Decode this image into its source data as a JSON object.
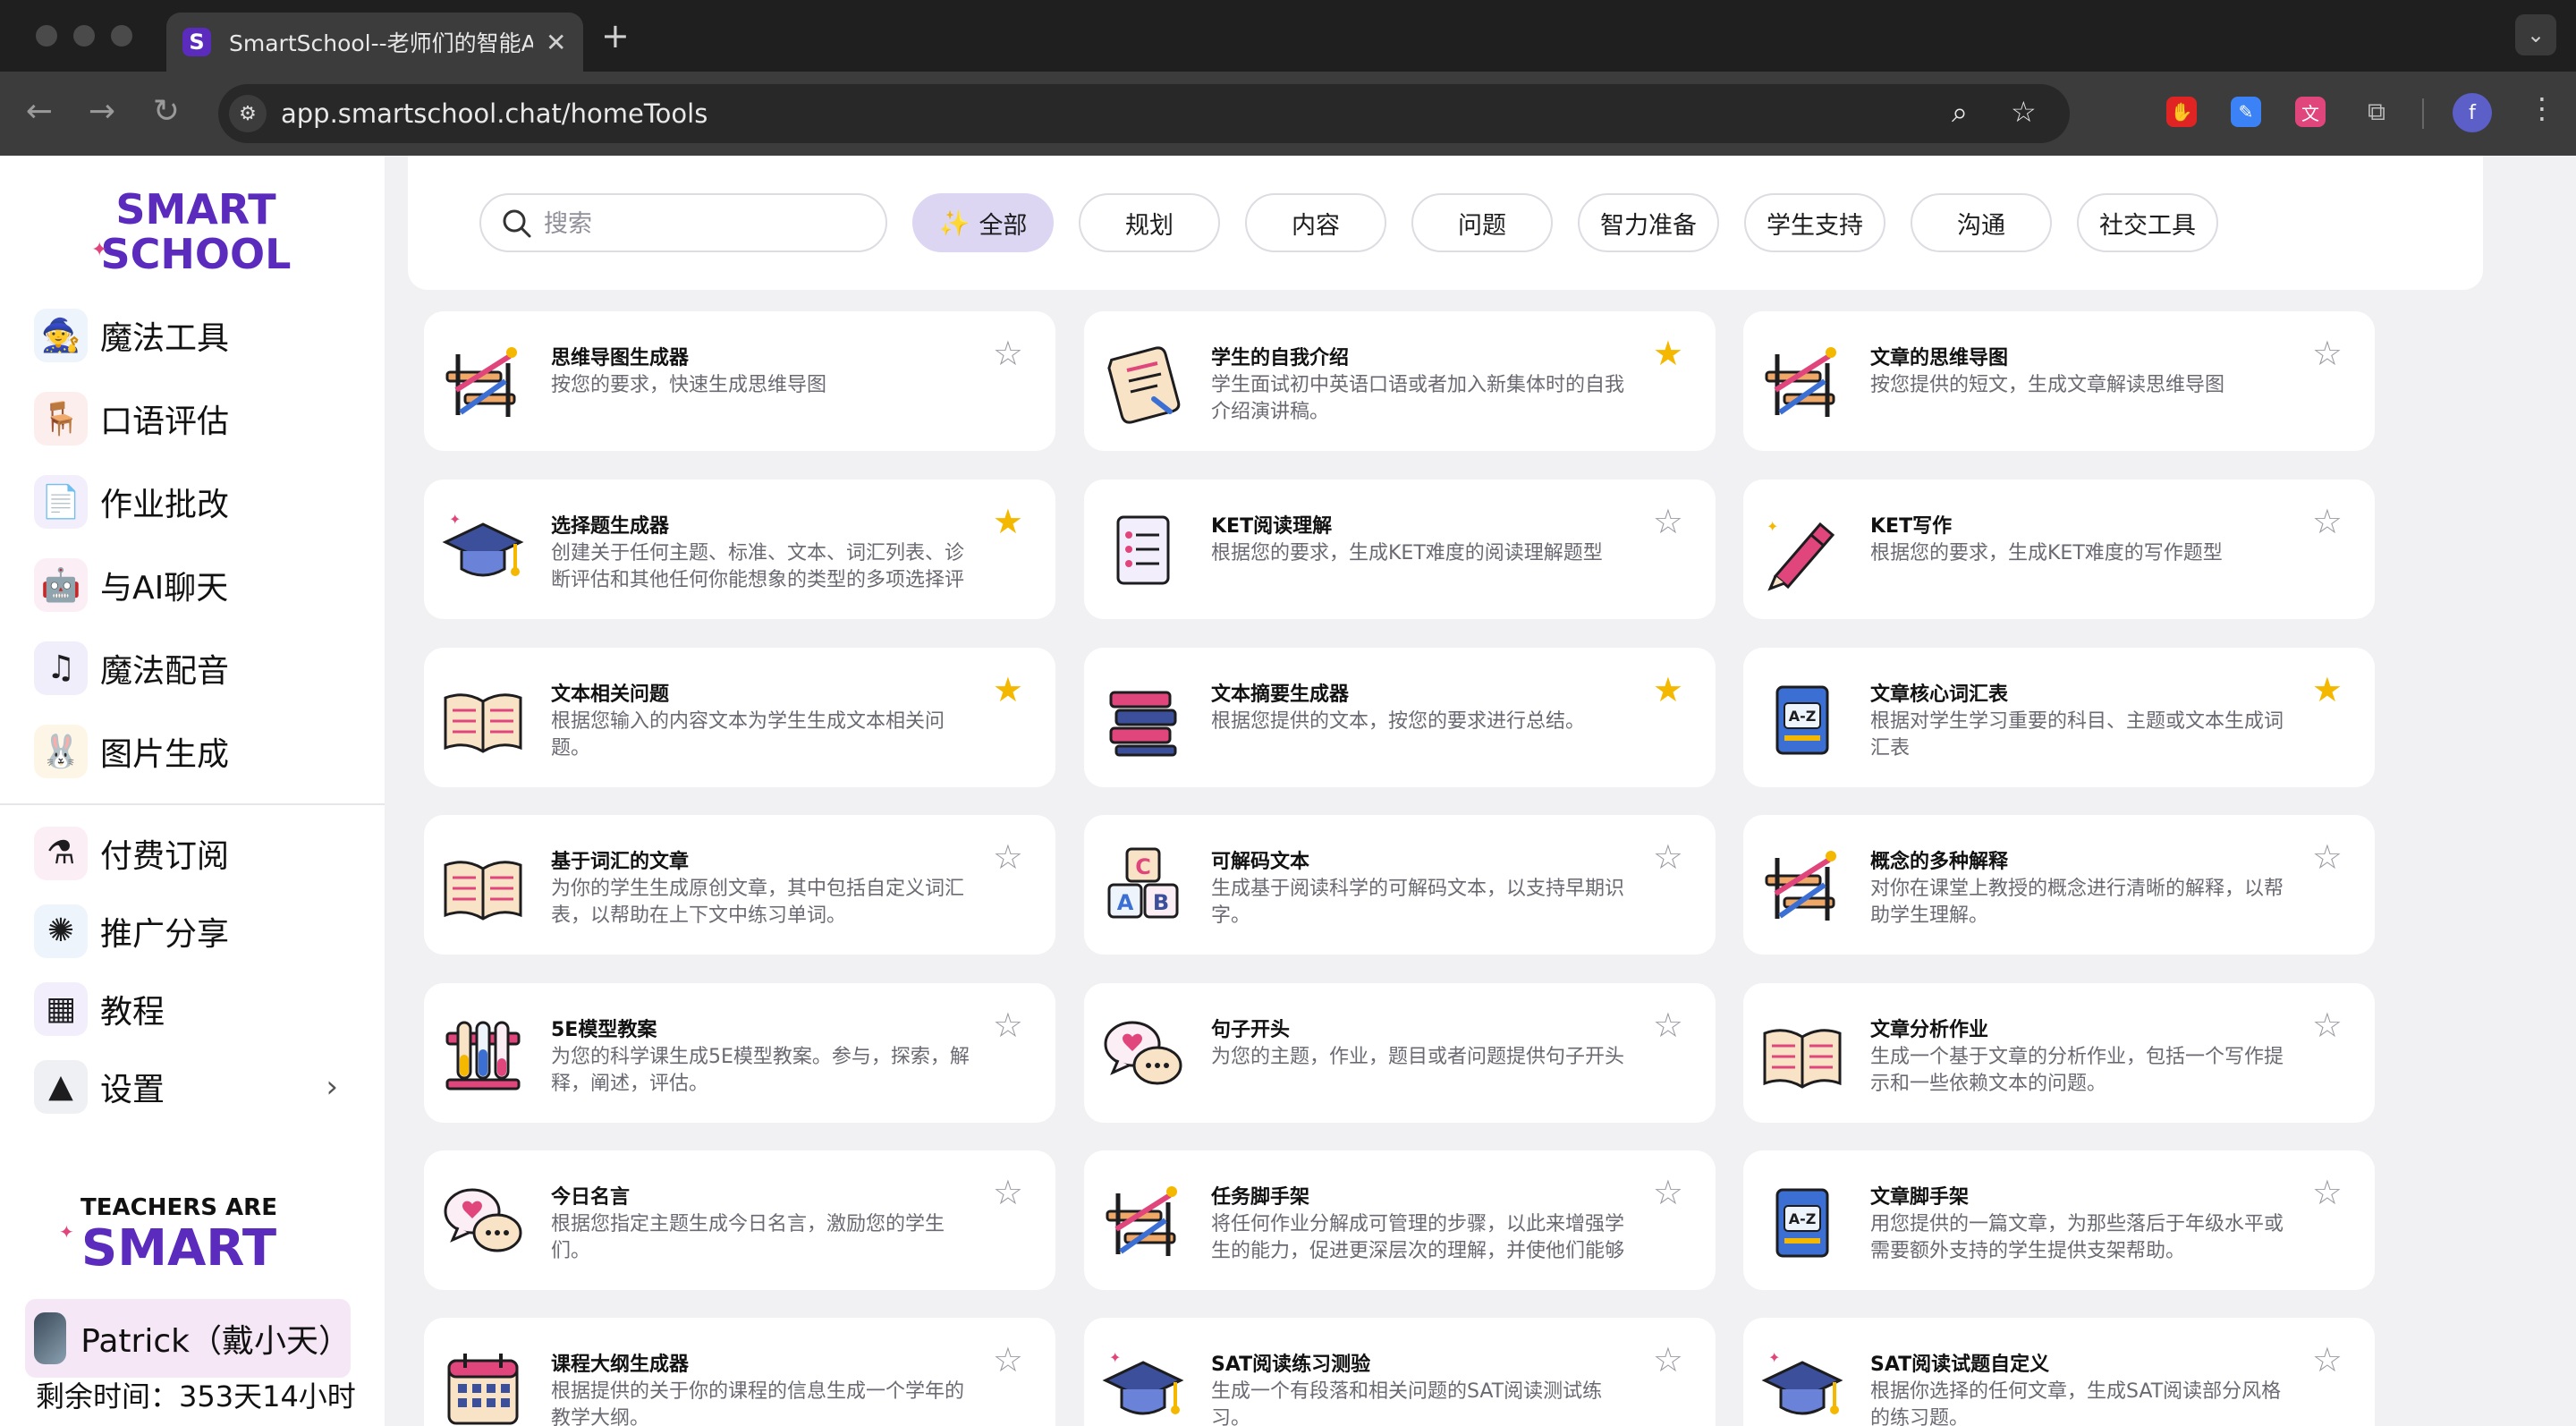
{
  "browser": {
    "tab_title": "SmartSchool--老师们的智能AI助手",
    "favicon_letter": "S",
    "new_tab": "+",
    "url": "app.smartschool.chat/homeTools"
  },
  "sidebar": {
    "logo_line1": "SMART",
    "logo_line2": "SCHOOL",
    "primary": [
      {
        "label": "魔法工具",
        "icon": "magic-wand-icon"
      },
      {
        "label": "口语评估",
        "icon": "desk-icon"
      },
      {
        "label": "作业批改",
        "icon": "homework-icon"
      },
      {
        "label": "与AI聊天",
        "icon": "robot-icon"
      },
      {
        "label": "魔法配音",
        "icon": "music-note-icon"
      },
      {
        "label": "图片生成",
        "icon": "rabbit-icon"
      }
    ],
    "secondary": [
      {
        "label": "付费订阅",
        "icon": "potion-icon"
      },
      {
        "label": "推广分享",
        "icon": "firework-icon"
      },
      {
        "label": "教程",
        "icon": "easel-icon"
      },
      {
        "label": "设置",
        "icon": "pyramid-icon"
      }
    ],
    "tas_line1": "TEACHERS ARE",
    "tas_line2": "SMART",
    "user_name": "Patrick（戴小天）",
    "remaining": "剩余时间：353天14小时"
  },
  "filters": {
    "search_placeholder": "搜索",
    "categories": [
      "全部",
      "规划",
      "内容",
      "问题",
      "智力准备",
      "学生支持",
      "沟通",
      "社交工具"
    ],
    "active": "全部"
  },
  "colors": {
    "accent": "#5b2bbd",
    "active_pill": "#dcd6f3",
    "star_favorite": "#f5b800"
  },
  "tools": [
    {
      "title": "思维导图生成器",
      "desc": "按您的要求，快速生成思维导图",
      "icon": "mindmap-icon",
      "favorite": false
    },
    {
      "title": "学生的自我介绍",
      "desc": "学生面试初中英语口语或者加入新集体时的自我介绍演讲稿。",
      "icon": "scroll-icon",
      "favorite": true
    },
    {
      "title": "文章的思维导图",
      "desc": "按您提供的短文，生成文章解读思维导图",
      "icon": "mindmap-icon",
      "favorite": false
    },
    {
      "title": "选择题生成器",
      "desc": "创建关于任何主题、标准、文本、词汇列表、诊断评估和其他任何你能想象的类型的多项选择评估。",
      "icon": "graduation-cap-icon",
      "favorite": true
    },
    {
      "title": "KET阅读理解",
      "desc": "根据您的要求，生成KET难度的阅读理解题型",
      "icon": "document-list-icon",
      "favorite": false
    },
    {
      "title": "KET写作",
      "desc": "根据您的要求，生成KET难度的写作题型",
      "icon": "pen-icon",
      "favorite": false
    },
    {
      "title": "文本相关问题",
      "desc": "根据您输入的内容文本为学生生成文本相关问题。",
      "icon": "open-book-icon",
      "favorite": true
    },
    {
      "title": "文本摘要生成器",
      "desc": "根据您提供的文本，按您的要求进行总结。",
      "icon": "book-stack-icon",
      "favorite": true
    },
    {
      "title": "文章核心词汇表",
      "desc": "根据对学生学习重要的科目、主题或文本生成词汇表",
      "icon": "dictionary-icon",
      "favorite": true
    },
    {
      "title": "基于词汇的文章",
      "desc": "为你的学生生成原创文章，其中包括自定义词汇表，以帮助在上下文中练习单词。",
      "icon": "open-book-icon",
      "favorite": false
    },
    {
      "title": "可解码文本",
      "desc": "生成基于阅读科学的可解码文本，以支持早期识字。",
      "icon": "abc-blocks-icon",
      "favorite": false
    },
    {
      "title": "概念的多种解释",
      "desc": "对你在课堂上教授的概念进行清晰的解释，以帮助学生理解。",
      "icon": "mindmap-icon",
      "favorite": false
    },
    {
      "title": "5E模型教案",
      "desc": "为您的科学课生成5E模型教案。参与，探索，解释，阐述，评估。",
      "icon": "test-tubes-icon",
      "favorite": false
    },
    {
      "title": "句子开头",
      "desc": "为您的主题，作业，题目或者问题提供句子开头",
      "icon": "chat-bubbles-icon",
      "favorite": false
    },
    {
      "title": "文章分析作业",
      "desc": "生成一个基于文章的分析作业，包括一个写作提示和一些依赖文本的问题。",
      "icon": "open-book-icon",
      "favorite": false
    },
    {
      "title": "今日名言",
      "desc": "根据您指定主题生成今日名言，激励您的学生们。",
      "icon": "chat-bubbles-icon",
      "favorite": false
    },
    {
      "title": "任务脚手架",
      "desc": "将任何作业分解成可管理的步骤，以此来增强学生的能力，促进更深层次的理解，并使他们能够更...",
      "icon": "mindmap-icon",
      "favorite": false
    },
    {
      "title": "文章脚手架",
      "desc": "用您提供的一篇文章，为那些落后于年级水平或需要额外支持的学生提供支架帮助。",
      "icon": "dictionary-icon",
      "favorite": false
    },
    {
      "title": "课程大纲生成器",
      "desc": "根据提供的关于你的课程的信息生成一个学年的教学大纲。",
      "icon": "calendar-icon",
      "favorite": false
    },
    {
      "title": "SAT阅读练习测验",
      "desc": "生成一个有段落和相关问题的SAT阅读测试练习。",
      "icon": "graduation-cap-icon",
      "favorite": false
    },
    {
      "title": "SAT阅读试题自定义",
      "desc": "根据你选择的任何文章，生成SAT阅读部分风格的练习题。",
      "icon": "graduation-cap-icon",
      "favorite": false
    }
  ]
}
